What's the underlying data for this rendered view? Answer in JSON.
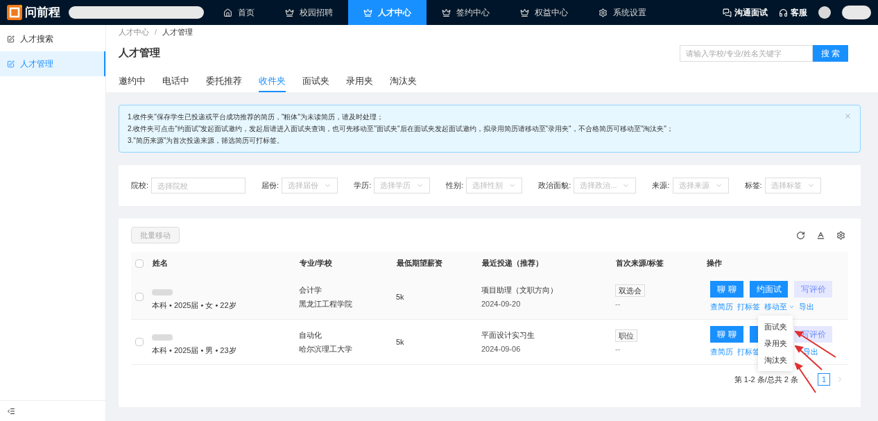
{
  "brand": {
    "name": "问前程"
  },
  "nav": [
    {
      "label": "首页",
      "selected": false
    },
    {
      "label": "校园招聘",
      "selected": false
    },
    {
      "label": "人才中心",
      "selected": true
    },
    {
      "label": "签约中心",
      "selected": false
    },
    {
      "label": "权益中心",
      "selected": false
    },
    {
      "label": "系统设置",
      "selected": false
    }
  ],
  "top_right": [
    {
      "label": "沟通面试"
    },
    {
      "label": "客服"
    }
  ],
  "sidebar": {
    "items": [
      {
        "label": "人才搜索",
        "selected": false
      },
      {
        "label": "人才管理",
        "selected": true
      }
    ]
  },
  "breadcrumb": [
    "人才中心",
    "人才管理"
  ],
  "breadcrumb_separator": "/",
  "page_title": "人才管理",
  "search": {
    "placeholder": "请输入学校/专业/姓名关键字",
    "button": "搜 索"
  },
  "tabs": [
    {
      "label": "邀约中",
      "selected": false
    },
    {
      "label": "电话中",
      "selected": false
    },
    {
      "label": "委托推荐",
      "selected": false
    },
    {
      "label": "收件夹",
      "selected": true
    },
    {
      "label": "面试夹",
      "selected": false
    },
    {
      "label": "录用夹",
      "selected": false
    },
    {
      "label": "淘汰夹",
      "selected": false
    }
  ],
  "notice": [
    "1.收件夹\"保存学生已投递或平台成功推荐的简历，\"粗体\"为未读简历，请及时处理；",
    "2.收件夹可点击\"约面试\"发起面试邀约，发起后请进入面试夹查询，也可先移动至\"面试夹\"后在面试夹发起面试邀约，拟录用简历请移动至\"录用夹\"，不合格简历可移动至\"淘汰夹\"；",
    "3.\"简历来源\"为首次投递来源，筛选简历可打标签。"
  ],
  "filters": [
    {
      "label": "院校:",
      "placeholder": "选择院校",
      "kind": "input"
    },
    {
      "label": "届份:",
      "placeholder": "选择届份",
      "kind": "select"
    },
    {
      "label": "学历:",
      "placeholder": "选择学历",
      "kind": "select"
    },
    {
      "label": "性别:",
      "placeholder": "选择性别",
      "kind": "select"
    },
    {
      "label": "政治面貌:",
      "placeholder": "选择政治...",
      "kind": "select"
    },
    {
      "label": "来源:",
      "placeholder": "选择来源",
      "kind": "select"
    },
    {
      "label": "标签:",
      "placeholder": "选择标签",
      "kind": "select"
    }
  ],
  "batch_button": {
    "label": "批量移动",
    "disabled": true
  },
  "header_checkbox": {
    "checked": false
  },
  "table": {
    "columns": [
      "姓名",
      "专业/学校",
      "最低期望薪资",
      "最近投递（推荐）",
      "首次来源/标签",
      "操作"
    ],
    "rows": [
      {
        "checked": false,
        "details": "本科 • 2025届 • 女 • 22岁",
        "major": "会计学",
        "school": "黑龙江工程学院",
        "salary": "5k",
        "job": "项目助理（文职方向）",
        "date": "2024-09-20",
        "tag": "双选会",
        "tag_note": "--",
        "buttons": [
          {
            "label": "聊 聊",
            "kind": "primary"
          },
          {
            "label": "约面试",
            "kind": "primary"
          },
          {
            "label": "写评价",
            "kind": "soft"
          }
        ],
        "links": [
          {
            "label": "查简历",
            "kind": "link"
          },
          {
            "label": "打标签",
            "kind": "link"
          },
          {
            "label": "移动至",
            "kind": "dropdown"
          },
          {
            "label": "导出",
            "kind": "link"
          }
        ]
      },
      {
        "checked": false,
        "details": "本科 • 2025届 • 男 • 23岁",
        "major": "自动化",
        "school": "哈尔滨理工大学",
        "salary": "5k",
        "job": "平面设计实习生",
        "date": "2024-09-06",
        "tag": "职位",
        "tag_note": "--",
        "buttons": [
          {
            "label": "聊 聊",
            "kind": "primary"
          },
          {
            "kind": "primary"
          },
          {
            "label": "写评价",
            "kind": "soft"
          }
        ],
        "links": [
          {
            "label": "查简历",
            "kind": "link"
          },
          {
            "label": "打标签",
            "kind": "link"
          },
          {
            "label": "导出",
            "kind": "link"
          }
        ]
      }
    ]
  },
  "move_menu": [
    "面试夹",
    "录用夹",
    "淘汰夹"
  ],
  "pagination": {
    "summary": "第 1-2 条/总共 2 条",
    "pages": [
      {
        "label": "1",
        "selected": true
      }
    ]
  }
}
